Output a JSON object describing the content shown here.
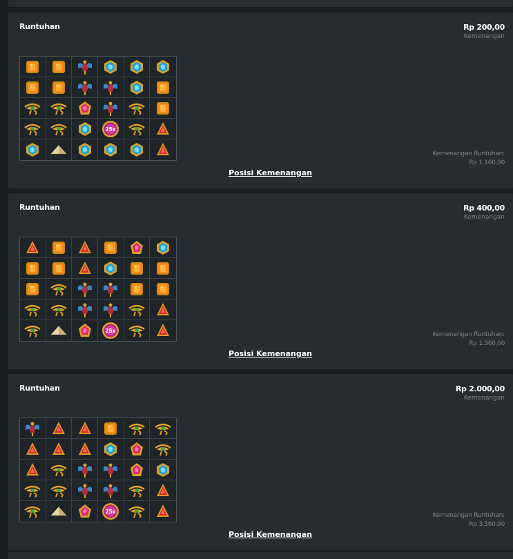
{
  "rounds": [
    {
      "title": "Runtuhan",
      "amount": "Rp 200,00",
      "amount_label": "Kemenangan",
      "cascade_label": "Kemenangan Runtuhan:",
      "cascade_value": "Rp 1.160,00",
      "link_label": "Posisi Kemenangan",
      "grid": [
        [
          "orange-gem-icon",
          "orange-gem-icon",
          "scarab-icon",
          "blue-gem-icon",
          "blue-gem-icon",
          "blue-gem-icon"
        ],
        [
          "orange-gem-icon",
          "orange-gem-icon",
          "scarab-icon",
          "scarab-icon",
          "blue-gem-icon",
          "orange-gem-icon"
        ],
        [
          "eye-of-horus-icon",
          "eye-of-horus-icon",
          "pink-gem-icon",
          "scarab-icon",
          "eye-of-horus-icon",
          "orange-gem-icon"
        ],
        [
          "eye-of-horus-icon",
          "eye-of-horus-icon",
          "blue-gem-icon",
          "multiplier-icon",
          "eye-of-horus-icon",
          "red-gem-icon"
        ],
        [
          "blue-gem-icon",
          "pyramid-icon",
          "blue-gem-icon",
          "blue-gem-icon",
          "blue-gem-icon",
          "red-gem-icon"
        ]
      ]
    },
    {
      "title": "Runtuhan",
      "amount": "Rp 400,00",
      "amount_label": "Kemenangan",
      "cascade_label": "Kemenangan Runtuhan:",
      "cascade_value": "Rp 1.560,00",
      "link_label": "Posisi Kemenangan",
      "grid": [
        [
          "red-gem-icon",
          "orange-gem-icon",
          "red-gem-icon",
          "orange-gem-icon",
          "pink-gem-icon",
          "blue-gem-icon"
        ],
        [
          "orange-gem-icon",
          "orange-gem-icon",
          "red-gem-icon",
          "blue-gem-icon",
          "orange-gem-icon",
          "orange-gem-icon"
        ],
        [
          "orange-gem-icon",
          "eye-of-horus-icon",
          "scarab-icon",
          "scarab-icon",
          "orange-gem-icon",
          "orange-gem-icon"
        ],
        [
          "eye-of-horus-icon",
          "eye-of-horus-icon",
          "scarab-icon",
          "scarab-icon",
          "eye-of-horus-icon",
          "red-gem-icon"
        ],
        [
          "eye-of-horus-icon",
          "pyramid-icon",
          "pink-gem-icon",
          "multiplier-icon",
          "eye-of-horus-icon",
          "red-gem-icon"
        ]
      ]
    },
    {
      "title": "Runtuhan",
      "amount": "Rp 2.000,00",
      "amount_label": "Kemenangan",
      "cascade_label": "Kemenangan Runtuhan:",
      "cascade_value": "Rp 3.560,00",
      "link_label": "Posisi Kemenangan",
      "grid": [
        [
          "scarab-icon",
          "red-gem-icon",
          "red-gem-icon",
          "orange-gem-icon",
          "eye-of-horus-icon",
          "eye-of-horus-icon"
        ],
        [
          "red-gem-icon",
          "red-gem-icon",
          "red-gem-icon",
          "blue-gem-icon",
          "pink-gem-icon",
          "eye-of-horus-icon"
        ],
        [
          "red-gem-icon",
          "eye-of-horus-icon",
          "scarab-icon",
          "scarab-icon",
          "pink-gem-icon",
          "blue-gem-icon"
        ],
        [
          "eye-of-horus-icon",
          "eye-of-horus-icon",
          "scarab-icon",
          "scarab-icon",
          "eye-of-horus-icon",
          "red-gem-icon"
        ],
        [
          "eye-of-horus-icon",
          "pyramid-icon",
          "pink-gem-icon",
          "multiplier-icon",
          "eye-of-horus-icon",
          "red-gem-icon"
        ]
      ]
    }
  ],
  "multiplier_text": "25x"
}
